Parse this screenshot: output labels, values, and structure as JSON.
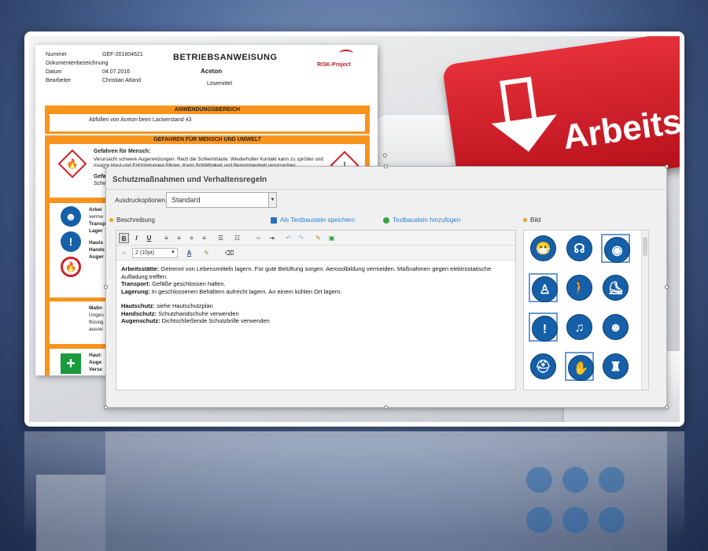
{
  "doc": {
    "meta": [
      {
        "label": "Nummer",
        "value": "GEF-201604621"
      },
      {
        "label": "Dokumentenbezeichnung",
        "value": ""
      },
      {
        "label": "Datum",
        "value": "04.07.2016"
      },
      {
        "label": "Bearbeiter",
        "value": "Christian Atland"
      }
    ],
    "title": "BETRIEBSANWEISUNG",
    "substance": "Aceton",
    "category": "Lösemittel",
    "logo_text": "RISK-Project",
    "section1_head": "ANWENDUNGSBEREICH",
    "section1_text": "Abfüllen von Aceton beim Lackierstand 43",
    "section2_head": "GEFAHREN FÜR MENSCH UND UMWELT",
    "section2_title": "Gefahren für Mensch:",
    "section2_text": "Verursacht schwere Augenreizungen. Reizt die Schleimhäute. Wiederholter Kontakt kann zu spröder und rissiger Haut und Entzündungen führen. Kann Schläfrigkeit und Benommenheit verursachen.",
    "section2_partial": "Gefah",
    "section2_partial2": "Schwa",
    "section3_lines": [
      "Arbei",
      "verme",
      "Transp",
      "Lager",
      "Hauts",
      "Hands",
      "Auger"
    ],
    "section4_lines": [
      "Maßn",
      "Unges",
      "flüssig",
      "ausrei"
    ],
    "section5_lines": [
      "Haut:",
      "Auge",
      "Versc"
    ]
  },
  "background": {
    "key_label": "Arbeitsschu"
  },
  "dialog": {
    "title": "Schutzmaßnahmen und Verhaltensregeln",
    "print_options_label": "Ausdruckoptionen",
    "print_options_value": "Standard",
    "description_label": "Beschreibung",
    "save_snippet": "Als Textbaustein speichern",
    "add_snippet": "Textbaustein hinzufügen",
    "image_label": "Bild",
    "font_size": "2 (10pt)",
    "content": [
      {
        "bold": "Arbeitsstätte:",
        "text": " Getrennt von Lebensmitteln lagern. Für gute Belüftung sorgen. Aerosolbildung vermeiden. Maßnahmen gegen elektrostatische Aufladung treffen."
      },
      {
        "bold": "Transport:",
        "text": " Gefäße geschlossen halten."
      },
      {
        "bold": "Lagerung:",
        "text": " In geschlossenen Behältern aufrecht lagern. An einem kühlen Ort lagern."
      },
      {
        "bold": "",
        "text": ""
      },
      {
        "bold": "Hautschutz:",
        "text": " siehe Hautschutzplan"
      },
      {
        "bold": "Handschutz:",
        "text": " Schutzhandschuhe verwenden"
      },
      {
        "bold": "Augenschutz:",
        "text": " Dichtschließende Schutzbrille verwenden"
      }
    ],
    "toolbar_row1": [
      {
        "name": "bold-button",
        "glyph": "B"
      },
      {
        "name": "italic-button",
        "glyph": "I"
      },
      {
        "name": "underline-button",
        "glyph": "U"
      },
      {
        "name": "align-left-button",
        "glyph": "≡"
      },
      {
        "name": "align-center-button",
        "glyph": "≡"
      },
      {
        "name": "align-right-button",
        "glyph": "≡"
      },
      {
        "name": "justify-button",
        "glyph": "≡"
      },
      {
        "name": "bullet-list-button",
        "glyph": "☰"
      },
      {
        "name": "numbered-list-button",
        "glyph": "☷"
      },
      {
        "name": "outdent-button",
        "glyph": "⇤"
      },
      {
        "name": "indent-button",
        "glyph": "⇥"
      },
      {
        "name": "undo-button",
        "glyph": "↶"
      },
      {
        "name": "redo-button",
        "glyph": "↷"
      },
      {
        "name": "edit-source-button",
        "glyph": "✎"
      },
      {
        "name": "insert-image-button",
        "glyph": "▣"
      }
    ],
    "pictograms": [
      {
        "name": "mask-icon",
        "glyph": "😷",
        "selected": false
      },
      {
        "name": "respirator-icon",
        "glyph": "☊",
        "selected": false
      },
      {
        "name": "face-shield-icon",
        "glyph": "◉",
        "selected": true
      },
      {
        "name": "protective-suit-icon",
        "glyph": "♙",
        "selected": true
      },
      {
        "name": "pedestrian-icon",
        "glyph": "🚶",
        "selected": false
      },
      {
        "name": "safety-boots-icon",
        "glyph": "⛸",
        "selected": false
      },
      {
        "name": "general-mandatory-icon",
        "glyph": "!",
        "selected": true
      },
      {
        "name": "ear-protection-icon",
        "glyph": "♫",
        "selected": false
      },
      {
        "name": "face-protection-icon",
        "glyph": "☻",
        "selected": false
      },
      {
        "name": "hard-hat-icon",
        "glyph": "⛑",
        "selected": false
      },
      {
        "name": "gloves-icon",
        "glyph": "✋",
        "selected": true
      },
      {
        "name": "coverall-icon",
        "glyph": "♜",
        "selected": false
      }
    ],
    "colors": {
      "accent": "#f7941d",
      "mandatory_blue": "#1560a8",
      "link": "#2a7fd0"
    }
  }
}
